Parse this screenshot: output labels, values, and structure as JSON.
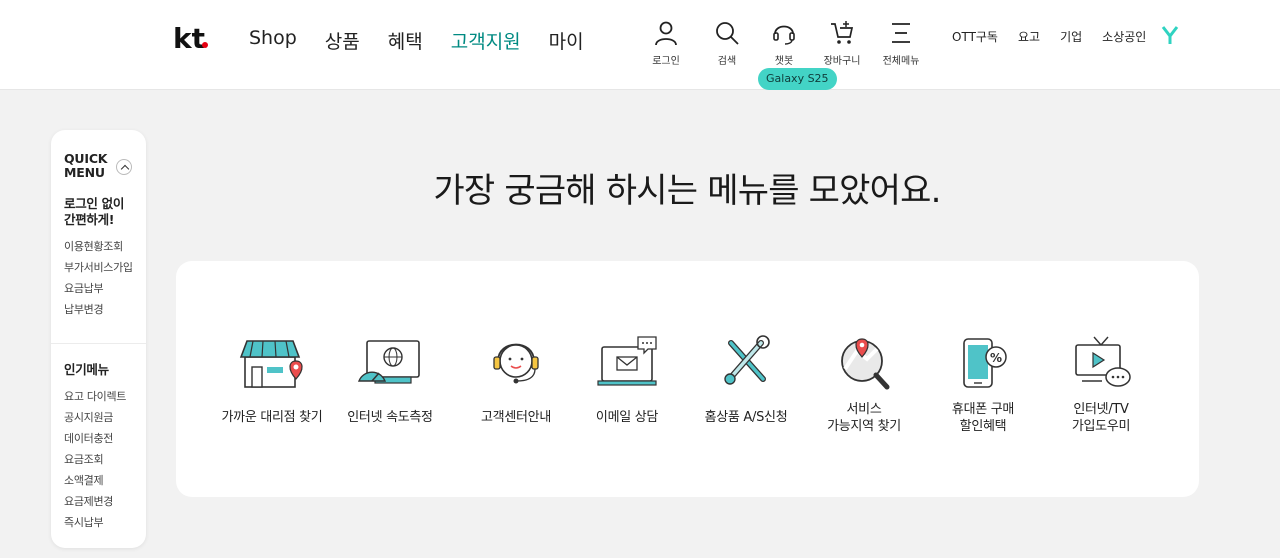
{
  "header": {
    "logo_text": "kt",
    "nav": [
      "Shop",
      "상품",
      "혜택",
      "고객지원",
      "마이"
    ],
    "active_nav": "고객지원",
    "utils": {
      "login": "로그인",
      "search": "검색",
      "chatbot": "챗봇",
      "cart": "장바구니",
      "menu": "전체메뉴"
    },
    "links": [
      "OTT구독",
      "요고",
      "기업",
      "소상공인"
    ],
    "tooltip": "Galaxy S25"
  },
  "quick_menu": {
    "title": "QUICK MENU",
    "section1_title": "로그인 없이 간편하게!",
    "section1_items": [
      "이용현황조회",
      "부가서비스가입",
      "요금납부",
      "납부변경"
    ],
    "section2_title": "인기메뉴",
    "section2_items": [
      "요고 다이렉트",
      "공시지원금",
      "데이터충전",
      "요금조회",
      "소액결제",
      "요금제변경",
      "즉시납부"
    ]
  },
  "main": {
    "title": "가장 궁금해 하시는 메뉴를 모았어요.",
    "items": [
      {
        "label": "가까운 대리점 찾기",
        "icon": "store-location-icon"
      },
      {
        "label": "인터넷 속도측정",
        "icon": "internet-speed-icon"
      },
      {
        "label": "고객센터안내",
        "icon": "headset-agent-icon"
      },
      {
        "label": "이메일 상담",
        "icon": "email-consult-icon"
      },
      {
        "label": "홈상품 A/S신청",
        "icon": "repair-tools-icon"
      },
      {
        "label": "서비스\n가능지역 찾기",
        "icon": "area-search-icon"
      },
      {
        "label": "휴대폰 구매\n할인혜택",
        "icon": "phone-discount-icon"
      },
      {
        "label": "인터넷/TV\n가입도우미",
        "icon": "tv-chat-icon"
      }
    ]
  },
  "colors": {
    "accent": "#008a82",
    "tooltip": "#43d4c6",
    "icon_teal": "#4fc3c8",
    "icon_red": "#ea4d4d",
    "page_bg": "#f2f2f2"
  }
}
